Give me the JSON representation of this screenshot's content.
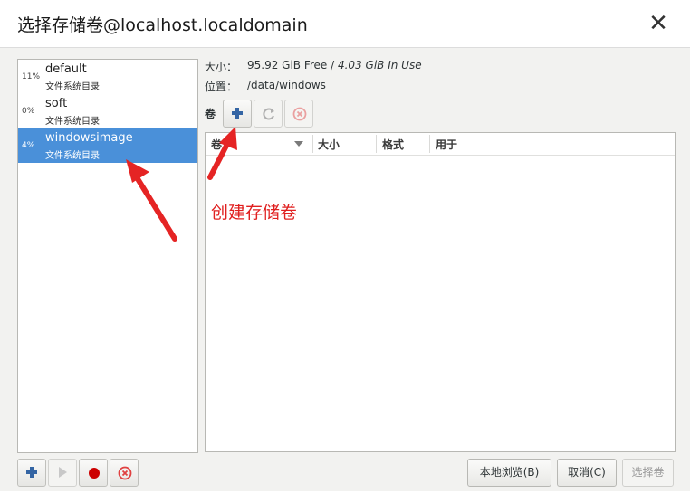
{
  "window": {
    "title": "选择存储卷@localhost.localdomain",
    "close_glyph": "✕"
  },
  "pools": [
    {
      "percent": "11%",
      "name": "default",
      "type": "文件系统目录",
      "selected": false
    },
    {
      "percent": "0%",
      "name": "soft",
      "type": "文件系统目录",
      "selected": false
    },
    {
      "percent": "4%",
      "name": "windowsimage",
      "type": "文件系统目录",
      "selected": true
    }
  ],
  "pool_info": {
    "size_label": "大小：",
    "size_free": "95.92 GiB Free",
    "size_sep": " / ",
    "size_inuse": "4.03 GiB In Use",
    "location_label": "位置：",
    "location_value": "/data/windows",
    "volumes_label": "卷"
  },
  "volume_toolbar": {
    "add_icon": "plus-icon",
    "refresh_icon": "refresh-icon",
    "delete_icon": "delete-icon"
  },
  "volume_table": {
    "columns": [
      "卷",
      "大小",
      "格式",
      "用于"
    ],
    "rows": []
  },
  "annotation": {
    "text": "创建存储卷",
    "color": "#e02020"
  },
  "bottom_buttons": {
    "browse_local": "本地浏览(B)",
    "cancel": "取消(C)",
    "choose_volume": "选择卷"
  },
  "colors": {
    "selected_row": "#4a90d9",
    "add_icon": "#3465a4",
    "stop_icon": "#cc0000",
    "delete_icon": "#e04040"
  }
}
